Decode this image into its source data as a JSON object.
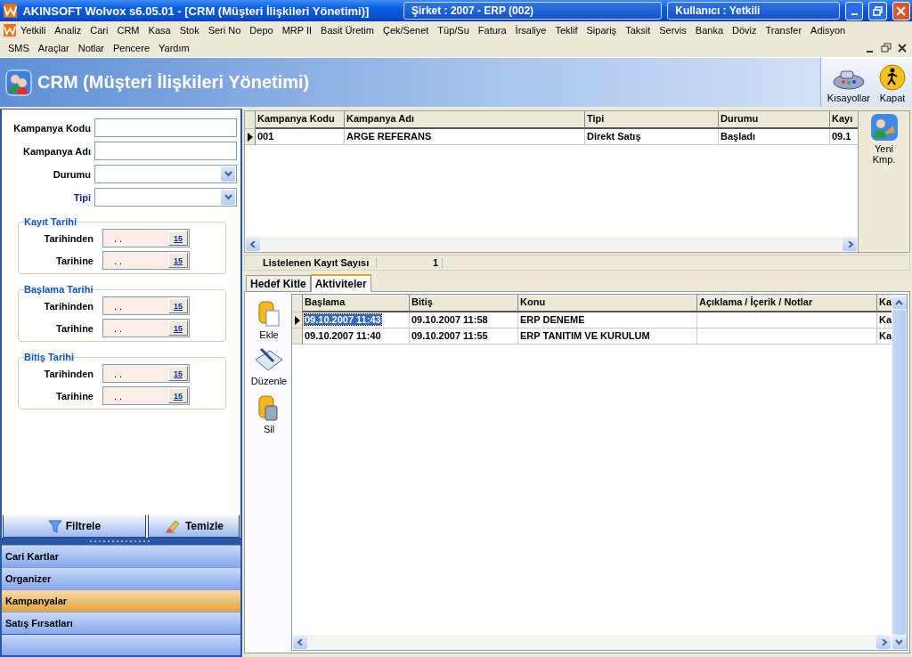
{
  "window": {
    "title": "AKINSOFT Wolvox s6.05.01 - [CRM (Müşteri İlişkileri Yönetimi)]",
    "company": "Şirket : 2007 - ERP (002)",
    "user": "Kullanıcı : Yetkili"
  },
  "menu_rows": [
    [
      "Yetkili",
      "Analiz",
      "Cari",
      "CRM",
      "Kasa",
      "Stok",
      "Seri No",
      "Depo",
      "MRP II",
      "Basit Üretim",
      "Çek/Senet",
      "Tüp/Su",
      "Fatura",
      "İrsaliye",
      "Teklif",
      "Sipariş",
      "Taksit",
      "Servis",
      "Banka",
      "Döviz",
      "Transfer",
      "Adisyon"
    ],
    [
      "SMS",
      "Araçlar",
      "Notlar",
      "Pencere",
      "Yardım"
    ]
  ],
  "header": {
    "title": "CRM (Müşteri İlişkileri Yönetimi)",
    "tools": [
      {
        "kind": "shortcuts",
        "label": "Kısayollar"
      },
      {
        "kind": "exit",
        "label": "Kapat"
      }
    ]
  },
  "filters": {
    "fields": [
      {
        "label": "Kampanya Kodu",
        "kind": "text",
        "highlight": false
      },
      {
        "label": "Kampanya Adı",
        "kind": "text",
        "highlight": false
      },
      {
        "label": "Durumu",
        "kind": "select",
        "highlight": false
      },
      {
        "label": "Tipi",
        "kind": "select",
        "highlight": true
      }
    ],
    "groups": [
      {
        "title": "Kayıt Tarihi",
        "rows": [
          {
            "label": "Tarihinden",
            "value": ". .",
            "calendar": "15"
          },
          {
            "label": "Tarihine",
            "value": ". .",
            "calendar": "15"
          }
        ]
      },
      {
        "title": "Başlama Tarihi",
        "rows": [
          {
            "label": "Tarihinden",
            "value": ". .",
            "calendar": "15"
          },
          {
            "label": "Tarihine",
            "value": ". .",
            "calendar": "15"
          }
        ]
      },
      {
        "title": "Bitiş Tarihi",
        "rows": [
          {
            "label": "Tarihinden",
            "value": ". .",
            "calendar": "15"
          },
          {
            "label": "Tarihine",
            "value": ". .",
            "calendar": "15"
          }
        ]
      }
    ],
    "buttons": [
      {
        "kind": "filter",
        "label": "Filtrele"
      },
      {
        "kind": "clear",
        "label": "Temizle"
      }
    ]
  },
  "nav": [
    {
      "label": "Cari Kartlar",
      "selected": false
    },
    {
      "label": "Organizer",
      "selected": false
    },
    {
      "label": "Kampanyalar",
      "selected": true
    },
    {
      "label": "Satış Fırsatları",
      "selected": false
    }
  ],
  "campaigns": {
    "columns": [
      "Kampanya Kodu",
      "Kampanya Adı",
      "Tipi",
      "Durumu",
      "Kayı"
    ],
    "rows": [
      {
        "selected": true,
        "cells": [
          "001",
          "ARGE REFERANS",
          "Direkt Satış",
          "Başladı",
          "09.1"
        ]
      }
    ],
    "side_button": "Yeni Kmp.",
    "count_label": "Listelenen Kayıt Sayısı",
    "count": "1"
  },
  "tabs": [
    {
      "label": "Hedef Kitle",
      "selected": false
    },
    {
      "label": "Aktiviteler",
      "selected": true
    }
  ],
  "activities": {
    "tools": [
      {
        "kind": "add",
        "label": "Ekle"
      },
      {
        "kind": "edit",
        "label": "Düzenle"
      },
      {
        "kind": "delete",
        "label": "Sil"
      }
    ],
    "columns": [
      "Başlama",
      "Bitiş",
      "Konu",
      "Açıklama / İçerik / Notlar",
      "Ka"
    ],
    "rows": [
      {
        "selected": true,
        "cells": [
          "09.10.2007 11:43",
          "09.10.2007 11:58",
          "ERP DENEME",
          "",
          "Ka"
        ]
      },
      {
        "selected": false,
        "cells": [
          "09.10.2007 11:40",
          "09.10.2007 11:55",
          "ERP TANITIM VE KURULUM",
          "",
          "Ka"
        ]
      }
    ]
  }
}
